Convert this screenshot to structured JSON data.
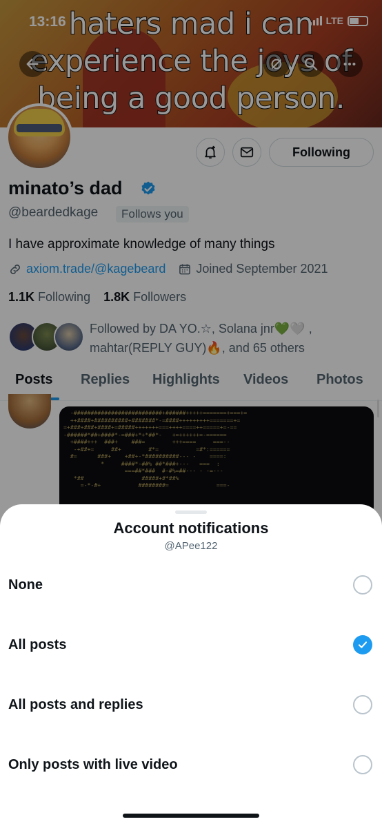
{
  "status_bar": {
    "time": "13:16",
    "network": "LTE"
  },
  "banner": {
    "meme_text_lines": [
      "haters mad i can",
      "experience the joys of",
      "being a good person."
    ]
  },
  "header_actions": {
    "following_label": "Following"
  },
  "profile": {
    "display_name": "minato’s dad",
    "handle": "@beardedkage",
    "follows_you": "Follows you",
    "bio": "I have approximate knowledge of many things",
    "link": "axiom.trade/@kagebeard",
    "joined": "Joined September 2021",
    "following_count": "1.1K",
    "following_label": "Following",
    "followers_count": "1.8K",
    "followers_label": "Followers",
    "followed_by_line1": "Followed by DA YO.☆, Solana jnr💚🤍 ,",
    "followed_by_line2": "mahtar(REPLY GUY)🔥, and 65 others"
  },
  "tabs": [
    "Posts",
    "Replies",
    "Highlights",
    "Videos",
    "Photos"
  ],
  "active_tab": "Posts",
  "sheet": {
    "title": "Account notifications",
    "subtitle": "@APee122",
    "options": [
      {
        "label": "None",
        "checked": false
      },
      {
        "label": "All posts",
        "checked": true
      },
      {
        "label": "All posts and replies",
        "checked": false
      },
      {
        "label": "Only posts with live video",
        "checked": false
      }
    ]
  },
  "colors": {
    "accent": "#1d9bf0",
    "text": "#0f1419",
    "muted": "#536471"
  }
}
